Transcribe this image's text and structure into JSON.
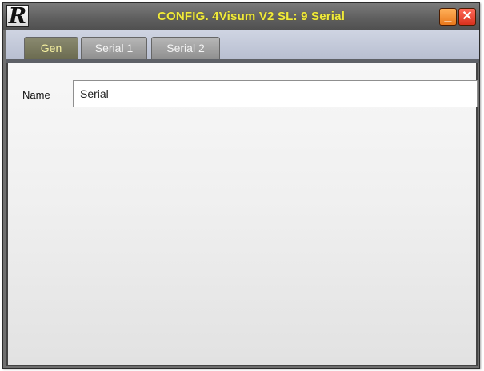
{
  "window": {
    "title": "CONFIG. 4Visum V2 SL: 9 Serial",
    "logo": "R",
    "minimize_label": "_",
    "close_label": "✕"
  },
  "tabs": [
    {
      "label": "Gen"
    },
    {
      "label": "Serial 1"
    },
    {
      "label": "Serial 2"
    }
  ],
  "form": {
    "name_label": "Name",
    "name_value": "Serial"
  },
  "colors": {
    "title_text": "#f0ea3c",
    "active_tab_text": "#f6f1a0"
  }
}
